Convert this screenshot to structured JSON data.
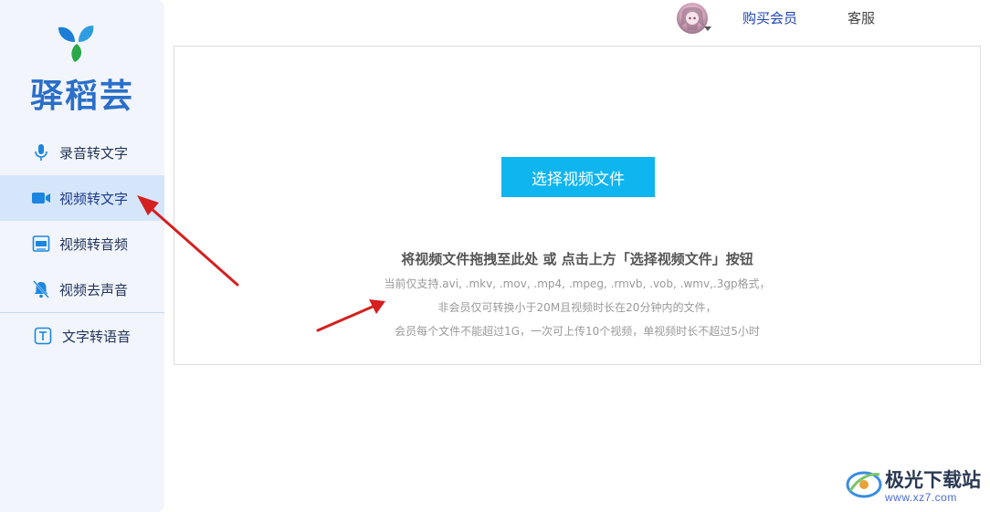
{
  "app": {
    "brand": "驿稻芸",
    "colors": {
      "brand_blue": "#2a6fc8",
      "button_cyan": "#0fb5ef",
      "sidebar_bg": "#f2f5fb",
      "active_bg": "#d5e5fa",
      "arrow_red": "#d42020"
    }
  },
  "sidebar": {
    "items": [
      {
        "label": "录音转文字",
        "icon": "microphone-icon",
        "active": false
      },
      {
        "label": "视频转文字",
        "icon": "video-camera-icon",
        "active": true
      },
      {
        "label": "视频转音频",
        "icon": "mp3-file-icon",
        "active": false
      },
      {
        "label": "视频去声音",
        "icon": "mute-bell-icon",
        "active": false
      },
      {
        "label": "文字转语音",
        "icon": "text-t-icon",
        "active": false
      }
    ]
  },
  "header": {
    "avatar": "user-avatar",
    "buy_member": "购买会员",
    "customer_service": "客服"
  },
  "upload": {
    "button_label": "选择视频文件",
    "title": "将视频文件拖拽至此处 或 点击上方「选择视频文件」按钮",
    "notes": [
      "当前仅支持.avi, .mkv, .mov, .mp4, .mpeg, .rmvb, .vob, .wmv,.3gp格式，",
      "非会员仅可转换小于20M且视频时长在20分钟内的文件，",
      "会员每个文件不能超过1G，一次可上传10个视频，单视频时长不超过5小时"
    ]
  },
  "watermark": {
    "title": "极光下载站",
    "url": "www.xz7.com"
  }
}
